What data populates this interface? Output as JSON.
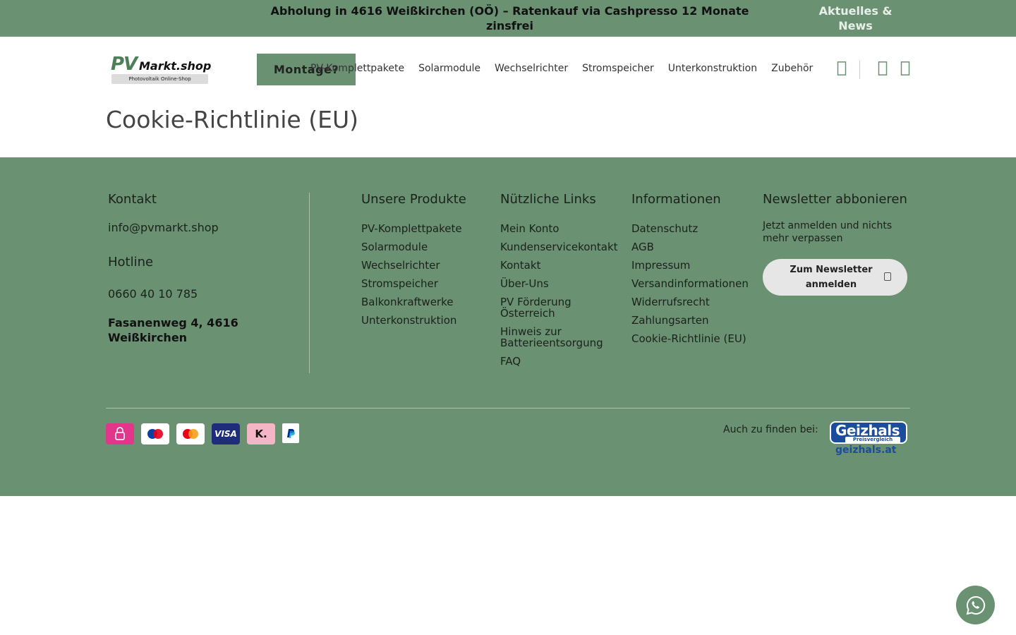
{
  "topbar": {
    "message": "Abholung in 4616 Weißkirchen (OÖ) – Ratenkauf via Cashpresso 12 Monate zinsfrei",
    "news_link": "Aktuelles & News"
  },
  "header": {
    "logo": {
      "pv": "PV",
      "markt": "Markt.shop",
      "subtitle": "Photovoltaik Online-Shop"
    },
    "montage_button": "Montage?",
    "nav": [
      "PV-Komplettpakete",
      "Solarmodule",
      "Wechselrichter",
      "Stromspeicher",
      "Unterkonstruktion",
      "Zubehör"
    ],
    "icons": [
      "search-icon",
      "user-icon",
      "cart-icon"
    ]
  },
  "page": {
    "title": "Cookie-Richtlinie (EU)"
  },
  "footer": {
    "kontakt": {
      "heading": "Kontakt",
      "email": "info@pvmarkt.shop",
      "hotline_heading": "Hotline",
      "phone": "0660 40 10 785",
      "address": "Fasanenweg 4, 4616 Weißkirchen"
    },
    "produkte": {
      "heading": "Unsere Produkte",
      "items": [
        "PV-Komplettpakete",
        "Solarmodule",
        "Wechselrichter",
        "Stromspeicher",
        "Balkonkraftwerke",
        "Unterkonstruktion"
      ]
    },
    "links": {
      "heading": "Nützliche Links",
      "items": [
        "Mein Konto",
        "Kundenservicekontakt",
        "Kontakt",
        "Über-Uns",
        "PV Förderung Österreich",
        "Hinweis zur Batterieentsorgung",
        "FAQ"
      ]
    },
    "informationen": {
      "heading": "Informationen",
      "items": [
        "Datenschutz",
        "AGB",
        "Impressum",
        "Versandinformationen",
        "Widerrufsrecht",
        "Zahlungsarten",
        "Cookie-Richtlinie (EU)"
      ]
    },
    "newsletter": {
      "heading": "Newsletter abbonieren",
      "text": "Jetzt anmelden und nichts mehr verpassen",
      "button": "Zum Newsletter anmelden"
    },
    "payments": [
      "cashpresso-icon",
      "maestro-icon",
      "mastercard-icon",
      "visa-icon",
      "klarna-icon",
      "paypal-icon"
    ],
    "payment_labels": {
      "visa": "VISA",
      "klarna": "K."
    },
    "auch": "Auch zu finden bei:",
    "geizhals": {
      "word": "Geizhals",
      "sub": "Preisvergleich",
      "domain": "geizhals.at"
    }
  },
  "colors": {
    "brand_green": "#6a9171",
    "logo_green": "#4d8057",
    "geizhals_blue": "#1c4c9c"
  }
}
